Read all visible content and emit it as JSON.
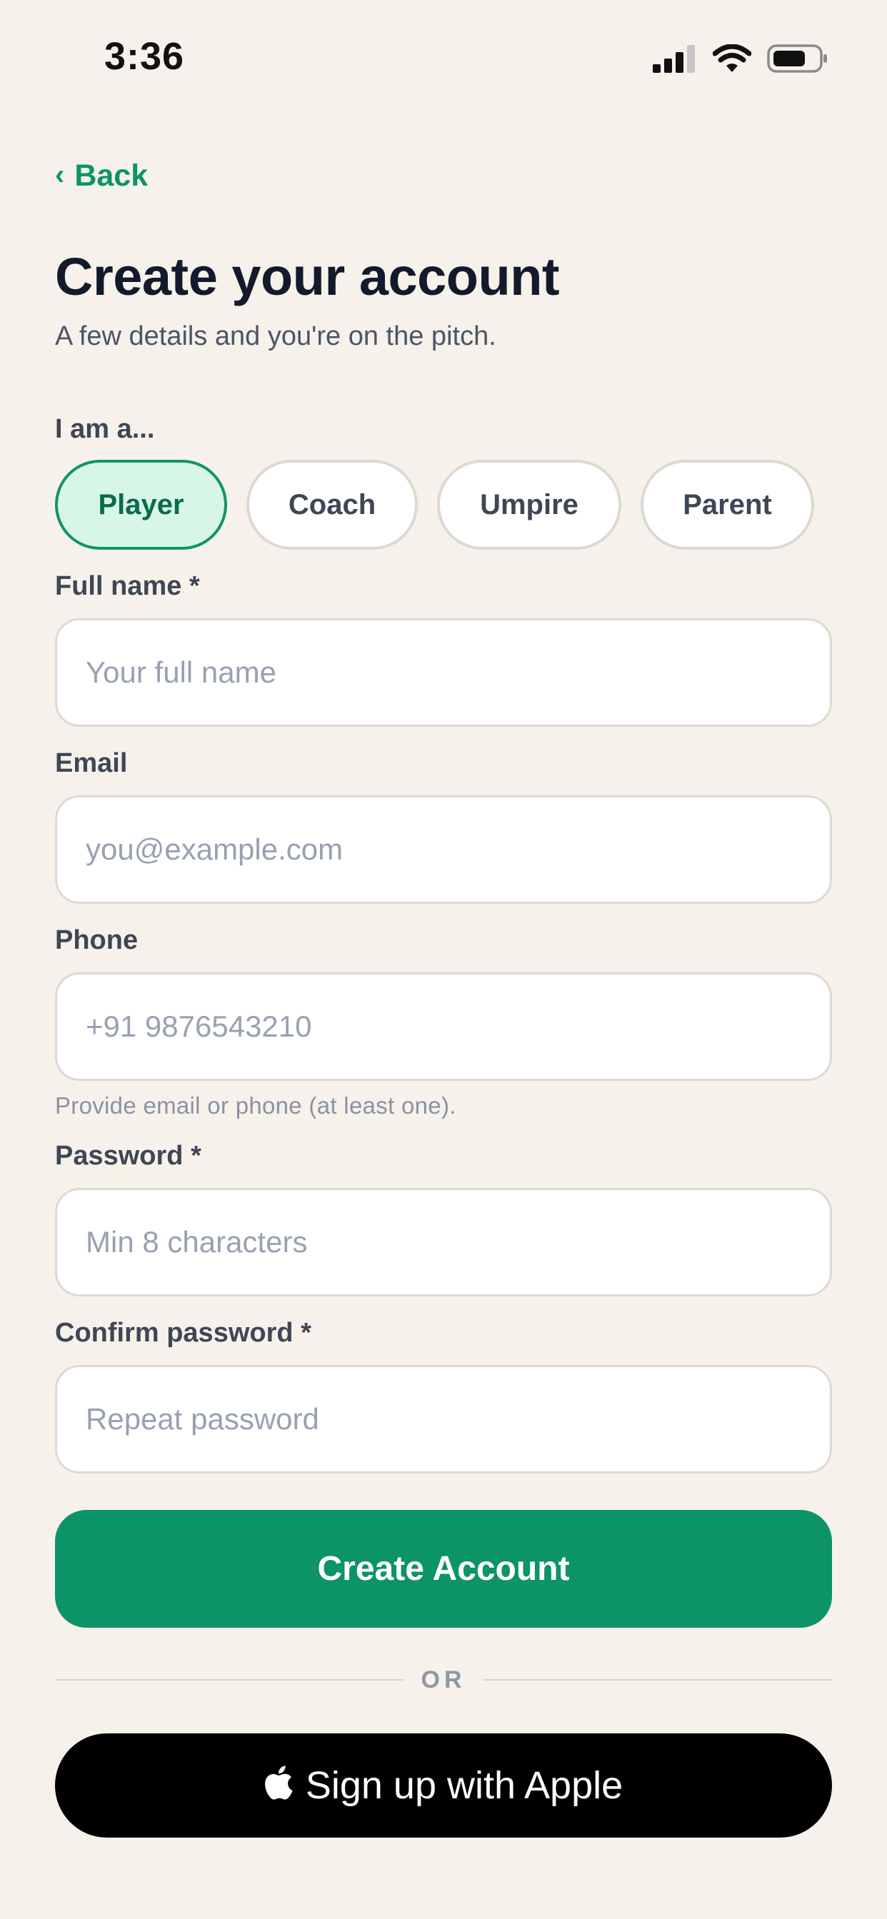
{
  "status_bar": {
    "time": "3:36",
    "icons": [
      "signal-icon",
      "wifi-icon",
      "battery-icon"
    ]
  },
  "nav": {
    "back_icon": "chevron-left-icon",
    "back_label": "Back"
  },
  "header": {
    "title": "Create your account",
    "subtitle": "A few details and you're on the pitch."
  },
  "role": {
    "label": "I am a...",
    "options": [
      "Player",
      "Coach",
      "Umpire",
      "Parent"
    ],
    "selected": "Player"
  },
  "form": {
    "full_name": {
      "label": "Full name *",
      "placeholder": "Your full name",
      "value": ""
    },
    "email": {
      "label": "Email",
      "placeholder": "you@example.com",
      "value": ""
    },
    "phone": {
      "label": "Phone",
      "placeholder": "+91 9876543210",
      "value": ""
    },
    "contact_hint": "Provide email or phone (at least one).",
    "password": {
      "label": "Password *",
      "placeholder": "Min 8 characters",
      "value": ""
    },
    "confirm_password": {
      "label": "Confirm password *",
      "placeholder": "Repeat password",
      "value": ""
    }
  },
  "actions": {
    "create_account": "Create Account",
    "divider": "OR",
    "apple_icon": "apple-icon",
    "apple_signup": "Sign up with Apple"
  },
  "colors": {
    "background": "#f6f2eb",
    "accent": "#0c9468",
    "selected_chip_bg": "#d8f6e6",
    "title": "#121a2c",
    "apple_button": "#000000"
  }
}
